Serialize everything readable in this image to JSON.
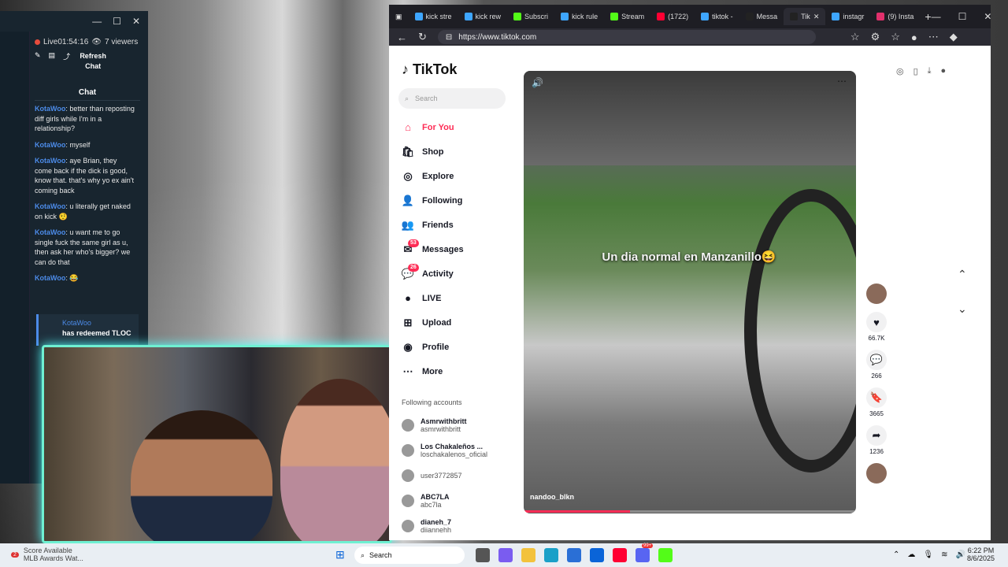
{
  "chat": {
    "live": "Live01:54:16",
    "viewers": "7 viewers",
    "refresh": "Refresh Chat",
    "title": "Chat",
    "messages": [
      {
        "user": "KotaWoo",
        "text": ": better than reposting diff girls while I'm in a relationship?"
      },
      {
        "user": "KotaWoo",
        "text": ": myself"
      },
      {
        "user": "KotaWoo",
        "text": ": aye Brian, they come back if the dick is good, know that. that's why yo ex ain't coming back"
      },
      {
        "user": "KotaWoo",
        "text": ": u literally get naked on kick 🤨"
      },
      {
        "user": "KotaWoo",
        "text": ": u want me to go single fuck the same girl as u, then ask her who's bigger? we can do that"
      },
      {
        "user": "KotaWoo",
        "text": ": 😂"
      }
    ],
    "redeem": {
      "user": "KotaWoo",
      "text": "has redeemed TLOC"
    }
  },
  "tabs": [
    {
      "label": "kick stre",
      "color": "#3ea6ff"
    },
    {
      "label": "kick rew",
      "color": "#3ea6ff"
    },
    {
      "label": "Subscri",
      "color": "#53fc18"
    },
    {
      "label": "kick rule",
      "color": "#3ea6ff"
    },
    {
      "label": "Stream",
      "color": "#53fc18"
    },
    {
      "label": "(1722)",
      "color": "#ff0033"
    },
    {
      "label": "tiktok -",
      "color": "#3ea6ff"
    },
    {
      "label": "Messa",
      "color": "#222"
    },
    {
      "label": "Tik",
      "color": "#222",
      "active": true
    },
    {
      "label": "instagr",
      "color": "#3ea6ff"
    },
    {
      "label": "(9) Insta",
      "color": "#e1306c"
    }
  ],
  "url": "https://www.tiktok.com",
  "tiktok": {
    "logo": "TikTok",
    "search": "Search",
    "nav": [
      {
        "label": "For You",
        "icon": "home-icon",
        "glyph": "⌂",
        "selected": true
      },
      {
        "label": "Shop",
        "icon": "shop-icon",
        "glyph": "🛍"
      },
      {
        "label": "Explore",
        "icon": "compass-icon",
        "glyph": "◎"
      },
      {
        "label": "Following",
        "icon": "following-icon",
        "glyph": "👤"
      },
      {
        "label": "Friends",
        "icon": "friends-icon",
        "glyph": "👥"
      },
      {
        "label": "Messages",
        "icon": "messages-icon",
        "glyph": "✉",
        "badge": "53"
      },
      {
        "label": "Activity",
        "icon": "activity-icon",
        "glyph": "💬",
        "badge": "26"
      },
      {
        "label": "LIVE",
        "icon": "live-icon",
        "glyph": "●"
      },
      {
        "label": "Upload",
        "icon": "upload-icon",
        "glyph": "⊞"
      },
      {
        "label": "Profile",
        "icon": "profile-icon",
        "glyph": "◉"
      },
      {
        "label": "More",
        "icon": "more-icon",
        "glyph": "⋯"
      }
    ],
    "following_title": "Following accounts",
    "accounts": [
      {
        "name": "Asmrwithbritt",
        "handle": "asmrwithbritt"
      },
      {
        "name": "Los Chakaleños ...",
        "handle": "loschakalenos_oficial"
      },
      {
        "name": "",
        "handle": "user3772857"
      },
      {
        "name": "ABC7LA",
        "handle": "abc7la"
      },
      {
        "name": "dianeh_7",
        "handle": "diiannehh"
      }
    ],
    "video": {
      "caption": "Un dia normal en Manzanillo😆",
      "author": "nandoo_blkn",
      "progress": 0.32
    },
    "actions": {
      "likes": "66.7K",
      "comments": "266",
      "saves": "3665",
      "shares": "1236"
    }
  },
  "taskbar": {
    "news1": "Score Available",
    "news2": "MLB Awards Wat...",
    "search": "Search",
    "time": "6:22 PM",
    "date": "8/6/2025",
    "notify": "2",
    "discord_badge": "99+"
  }
}
